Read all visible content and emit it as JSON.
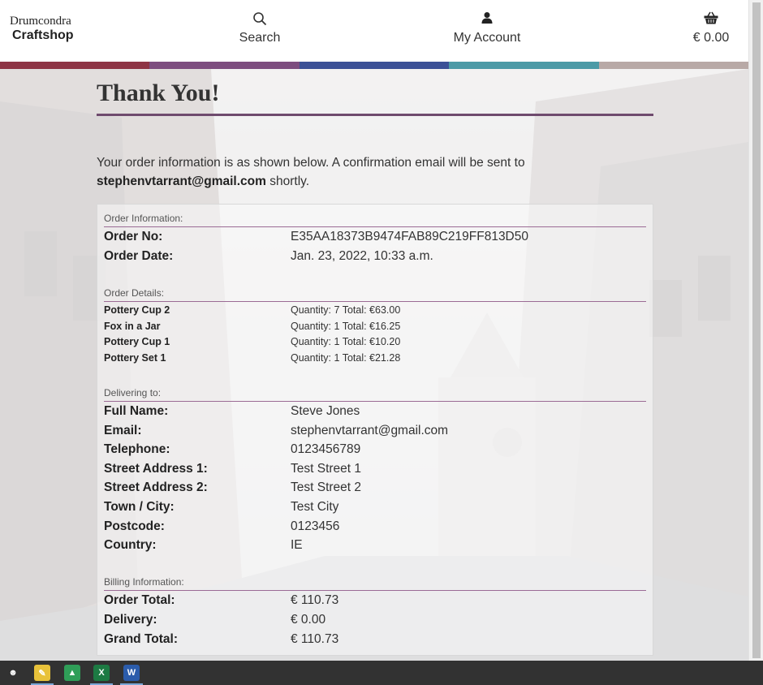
{
  "header": {
    "brand_line1": "Drumcondra",
    "brand_line2": "Craftshop",
    "search_label": "Search",
    "account_label": "My Account",
    "bag_total": "€ 0.00"
  },
  "stripe_colors": [
    "#8e3445",
    "#7d4d7f",
    "#3b5096",
    "#4c9aa6",
    "#b8a9a6"
  ],
  "page": {
    "title": "Thank You!",
    "intro_text": "Your order information is as shown below. A confirmation email will be sent to",
    "email": "stephenvtarrant@gmail.com",
    "intro_tail": "shortly."
  },
  "order_info": {
    "label": "Order Information:",
    "order_no_key": "Order No:",
    "order_no": "E35AA18373B9474FAB89C219FF813D50",
    "order_date_key": "Order Date:",
    "order_date": "Jan. 23, 2022, 10:33 a.m."
  },
  "order_details": {
    "label": "Order Details:",
    "items": [
      {
        "name": "Pottery Cup 2",
        "detail": "Quantity: 7 Total: €63.00"
      },
      {
        "name": "Fox in a Jar",
        "detail": "Quantity: 1 Total: €16.25"
      },
      {
        "name": "Pottery Cup 1",
        "detail": "Quantity: 1 Total: €10.20"
      },
      {
        "name": "Pottery Set 1",
        "detail": "Quantity: 1 Total: €21.28"
      }
    ]
  },
  "delivery": {
    "label": "Delivering to:",
    "rows": [
      {
        "key": "Full Name:",
        "value": "Steve Jones"
      },
      {
        "key": "Email:",
        "value": "stephenvtarrant@gmail.com"
      },
      {
        "key": "Telephone:",
        "value": "0123456789"
      },
      {
        "key": "Street Address 1:",
        "value": "Test Street 1"
      },
      {
        "key": "Street Address 2:",
        "value": "Test Street 2"
      },
      {
        "key": "Town / City:",
        "value": "Test City"
      },
      {
        "key": "Postcode:",
        "value": "0123456"
      },
      {
        "key": "Country:",
        "value": "IE"
      }
    ]
  },
  "billing": {
    "label": "Billing Information:",
    "rows": [
      {
        "key": "Order Total:",
        "value": "€ 110.73"
      },
      {
        "key": "Delivery:",
        "value": "€ 0.00"
      },
      {
        "key": "Grand Total:",
        "value": "€ 110.73"
      }
    ]
  },
  "taskbar": {
    "items": [
      {
        "icon": "smiley-icon",
        "glyph": "☻",
        "color": "#323232"
      },
      {
        "icon": "notepad-icon",
        "glyph": "✎",
        "color": "#e8c23a"
      },
      {
        "icon": "drive-icon",
        "glyph": "▲",
        "color": "#2f9e58"
      },
      {
        "icon": "excel-icon",
        "glyph": "X",
        "color": "#1d7a43"
      },
      {
        "icon": "word-icon",
        "glyph": "W",
        "color": "#2b5cab"
      }
    ]
  }
}
